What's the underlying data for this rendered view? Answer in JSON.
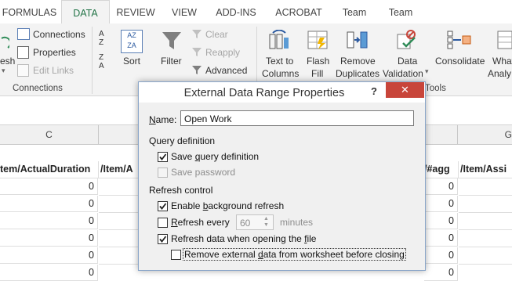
{
  "ribbon": {
    "tabs": [
      "FORMULAS",
      "DATA",
      "REVIEW",
      "VIEW",
      "ADD-INS",
      "ACROBAT",
      "Team",
      "Team"
    ],
    "active_tab": "DATA",
    "refresh_partial": "esh",
    "connections": "Connections",
    "properties": "Properties",
    "edit_links": "Edit Links",
    "connections_group": "Connections",
    "sort": "Sort",
    "filter": "Filter",
    "clear": "Clear",
    "reapply": "Reapply",
    "advanced": "Advanced",
    "text_to_columns_1": "Text to",
    "text_to_columns_2": "Columns",
    "flash_fill_1": "Flash",
    "flash_fill_2": "Fill",
    "remove_dup_1": "Remove",
    "remove_dup_2": "Duplicates",
    "data_validation_1": "Data",
    "data_validation_2": "Validation",
    "consolidate": "Consolidate",
    "whatif_1": "What",
    "whatif_2": "Analy",
    "tools_group": "Tools",
    "sort_az_top": "A Z",
    "sort_az_bottom": "Z A"
  },
  "sheet": {
    "columns": [
      "C",
      "G"
    ],
    "headers": [
      "tem/ActualDuration",
      "/Item/A",
      "/#agg",
      "/Item/Assi"
    ],
    "values": [
      "0",
      "0",
      "0",
      "0",
      "0",
      "0"
    ],
    "values_right": [
      "0",
      "0",
      "0",
      "0",
      "0",
      "0"
    ]
  },
  "dialog": {
    "title": "External Data Range Properties",
    "help": "?",
    "close": "✕",
    "name_label": "Name:",
    "name_value": "Open Work",
    "query_section": "Query definition",
    "save_query": "Save query definition",
    "save_password": "Save password",
    "refresh_section": "Refresh control",
    "enable_background": "Enable background refresh",
    "refresh_every": "Refresh every",
    "refresh_minutes_value": "60",
    "minutes": "minutes",
    "refresh_on_open": "Refresh data when opening the file",
    "remove_external": "Remove external data from worksheet before closing",
    "checks": {
      "save_query": true,
      "save_password": false,
      "enable_background": true,
      "refresh_every": false,
      "refresh_on_open": true,
      "remove_external": false
    }
  },
  "colors": {
    "accent": "#217346",
    "close_button": "#c8453a",
    "dialog_border": "#8aa6c9"
  }
}
